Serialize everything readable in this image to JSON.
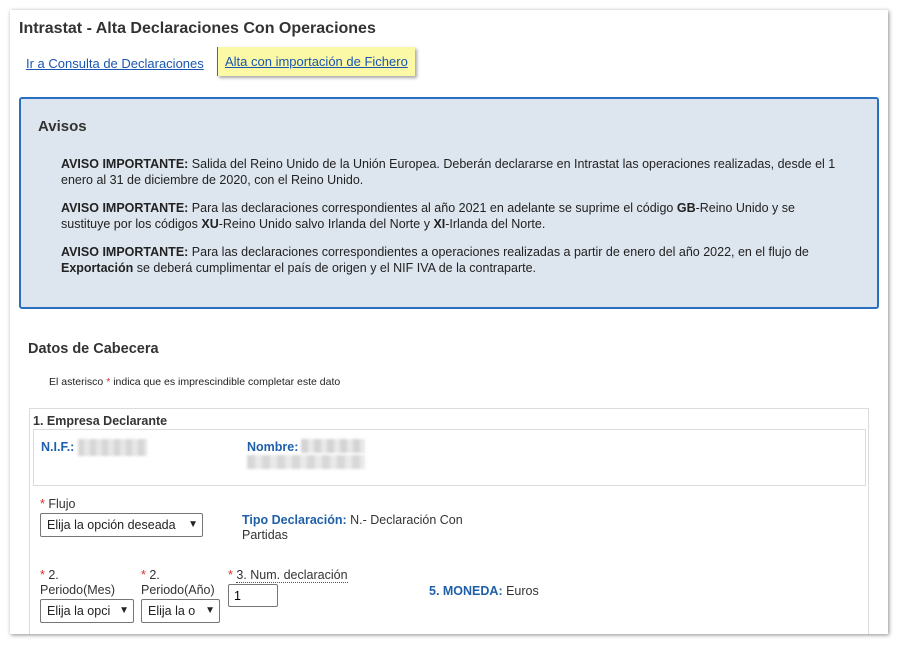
{
  "header": {
    "title": "Intrastat - Alta Declaraciones Con Operaciones",
    "link_consulta": "Ir a Consulta de Declaraciones",
    "link_import": "Alta con importación de Fichero"
  },
  "avisos": {
    "title": "Avisos",
    "items": [
      {
        "prefix": "AVISO IMPORTANTE:",
        "line1": " Salida del Reino Unido de la Unión Europea. Deberán declararse en Intrastat las operaciones realizadas, desde el 1",
        "line2": "enero al 31 de diciembre de 2020, con el Reino Unido."
      },
      {
        "prefix": "AVISO IMPORTANTE:",
        "t1": " Para las declaraciones correspondientes al año 2021 en adelante se suprime el código ",
        "b1": "GB",
        "t2": "-Reino Unido y se",
        "t3": "sustituye por los códigos ",
        "b2": "XU",
        "t4": "-Reino Unido salvo Irlanda del Norte y ",
        "b3": "XI",
        "t5": "-Irlanda del Norte."
      },
      {
        "prefix": "AVISO IMPORTANTE:",
        "t1": " Para las declaraciones correspondientes a operaciones realizadas a partir de enero del año 2022, en el flujo de",
        "b1": "Exportación",
        "t2": " se deberá cumplimentar el país de origen y el NIF IVA de la contraparte."
      }
    ]
  },
  "cabecera": {
    "title": "Datos de Cabecera",
    "note_pre": "El asterisco ",
    "asterisk": "*",
    "note_post": " indica que es imprescindible completar este dato",
    "empresa_title": "1. Empresa Declarante",
    "nif_label": "N.I.F.:",
    "nombre_label": "Nombre:"
  },
  "form": {
    "req_mark": "*",
    "flujo_label": "Flujo",
    "flujo_value": "Elija la opción deseada",
    "tipo_label": "Tipo Declaración:",
    "tipo_value": " N.- Declaración Con",
    "tipo_value2": "Partidas",
    "periodo_mes_label1": "2.",
    "periodo_mes_label2": "Periodo(Mes)",
    "periodo_mes_value": "Elija la opci",
    "periodo_anio_label1": "2.",
    "periodo_anio_label2": "Periodo(Año)",
    "periodo_anio_value": "Elija la o",
    "num_decl_label": "3. Num. declaración",
    "num_decl_value": "1",
    "moneda_label": "5. MONEDA:",
    "moneda_value": " Euros"
  },
  "icons": {
    "select_chevron": "chevron-down-icon"
  }
}
